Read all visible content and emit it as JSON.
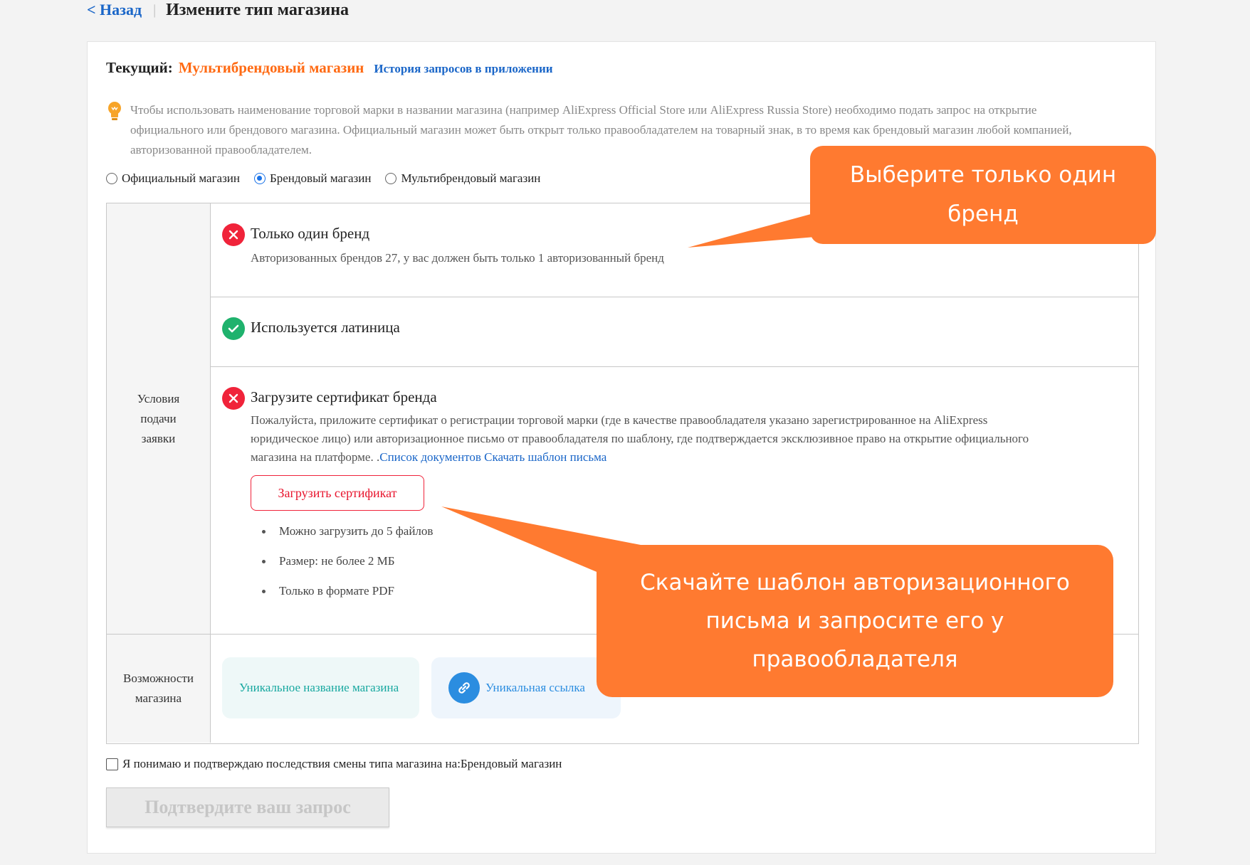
{
  "header": {
    "back_label": "< Назад",
    "separator": "|",
    "title": "Измените тип магазина"
  },
  "current": {
    "label": "Текущий:",
    "value": "Мультибрендовый магазин",
    "history_link": "История запросов в приложении"
  },
  "hint": {
    "text": "Чтобы использовать наименование торговой марки в названии магазина (например AliExpress Official Store или AliExpress Russia Store) необходимо подать запрос на открытие официального или брендового магазина. Официальный магазин может быть открыт только правообладателем на товарный знак, в то время как брендовый магазин любой компанией, авторизованной правообладателем."
  },
  "store_types": {
    "options": [
      "Официальный магазин",
      "Брендовый магазин",
      "Мультибрендовый магазин"
    ],
    "selected": "Брендовый магазин"
  },
  "conditions": {
    "section_label": "Условия подачи заявки",
    "items": [
      {
        "status": "error",
        "title": "Только один бренд",
        "desc": "Авторизованных брендов 27, у вас должен быть только 1 авторизованный бренд"
      },
      {
        "status": "ok",
        "title": "Используется латиница"
      },
      {
        "status": "error",
        "title": "Загрузите сертификат бренда",
        "desc": "Пожалуйста, приложите сертификат о регистрации торговой марки (где в качестве правообладателя указано зарегистрированное на AliExpress юридическое лицо) или авторизационное письмо от правообладателя по шаблону, где подтверждается эксклюзивное право на открытие официального магазина на платформе. .",
        "docs_link": "Список документов",
        "template_link": "Скачать шаблон письма",
        "upload_button": "Загрузить сертификат",
        "requirements": [
          "Можно загрузить до 5 файлов",
          "Размер: не более 2 МБ",
          "Только в формате PDF"
        ]
      }
    ]
  },
  "features": {
    "section_label": "Возможности магазина",
    "items": [
      {
        "label": "Уникальное название магазина",
        "icon": "none"
      },
      {
        "label": "Уникальная ссылка",
        "icon": "link-icon"
      }
    ]
  },
  "confirm": {
    "checkbox_label": "Я понимаю и подтверждаю последствия смены типа магазина на:Брендовый магазин",
    "checked": false,
    "submit_label": "Подтвердите ваш запрос",
    "submit_enabled": false
  },
  "callouts": [
    "Выберите только один бренд",
    "Скачайте шаблон авторизационного письма и запросите его у правообладателя"
  ],
  "colors": {
    "accent_orange": "#ff6a13",
    "callout": "#ff7a30",
    "link_blue": "#1a66c8",
    "error_red": "#f0233a",
    "ok_green": "#1fb26d"
  }
}
